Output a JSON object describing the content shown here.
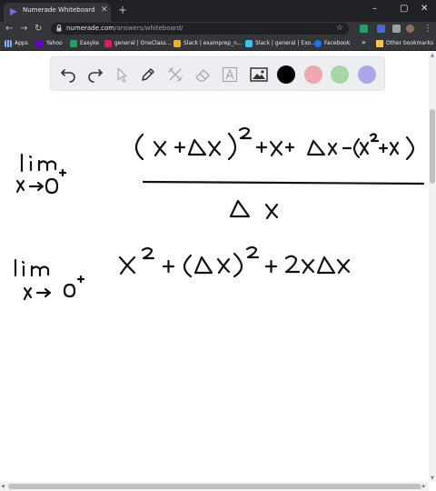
{
  "browser": {
    "tab": {
      "title": "Numerade Whiteboard",
      "close_icon": "close-icon"
    },
    "window_controls": [
      "minimize-icon",
      "maximize-icon",
      "close-icon"
    ],
    "url": {
      "host": "numerade.com",
      "path": "/answers/whiteboard/"
    }
  },
  "bookmarks": [
    {
      "label": "Apps",
      "icon": "apps-grid-icon",
      "color": "#8ab4f8"
    },
    {
      "label": "Yahoo",
      "icon": "yahoo-icon",
      "color": "#6001d2"
    },
    {
      "label": "Easyke",
      "icon": "easyke-icon",
      "color": "#1ea362"
    },
    {
      "label": "general | OneClass...",
      "icon": "slack-icon",
      "color": "#e01e5a"
    },
    {
      "label": "Slack | examprep_n...",
      "icon": "slack-icon",
      "color": "#ecb22e"
    },
    {
      "label": "Slack | general | Exo...",
      "icon": "slack-icon",
      "color": "#36c5f0"
    },
    {
      "label": "Facebook",
      "icon": "facebook-icon",
      "color": "#1877f2"
    },
    {
      "label": "Other bookmarks",
      "icon": "folder-icon",
      "color": "#f6c344"
    }
  ],
  "whiteboard": {
    "tools": [
      "undo-icon",
      "redo-icon",
      "select-cursor-icon",
      "pen-icon",
      "tools-icon",
      "eraser-icon",
      "text-icon",
      "image-icon"
    ],
    "colors": [
      "#000000",
      "#f0a6ad",
      "#a8d5a6",
      "#aaa7e6"
    ],
    "selected_color": "#000000"
  }
}
